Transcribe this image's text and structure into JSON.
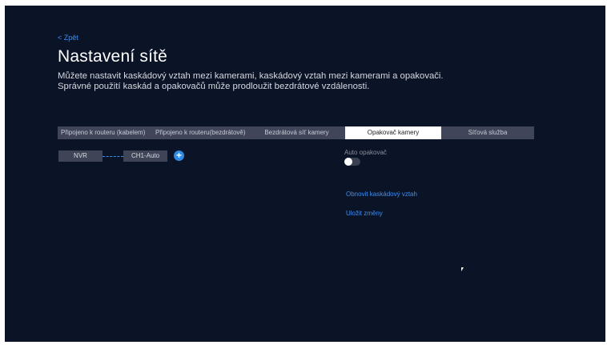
{
  "header": {
    "back_label": "< Zpět",
    "title": "Nastavení sítě",
    "description": "Můžete nastavit kaskádový vztah mezi kamerami, kaskádový vztah mezi kamerami a opakovači. Správné použití kaskád a opakovačů může prodloužit bezdrátové vzdálenosti."
  },
  "tabs": [
    {
      "label": "Připojeno k routeru (kabelem)",
      "active": false
    },
    {
      "label": "Připojeno k routeru(bezdrátově)",
      "active": false
    },
    {
      "label": "Bezdrátová síť kamery",
      "active": false
    },
    {
      "label": "Opakovač kamery",
      "active": true
    },
    {
      "label": "Síťová služba",
      "active": false
    }
  ],
  "topology": {
    "root_label": "NVR",
    "child_label": "CH1-Auto",
    "add_icon": "plus-circle-icon"
  },
  "settings": {
    "auto_repeater_label": "Auto opakovač",
    "auto_repeater_enabled": false
  },
  "actions": {
    "refresh_label": "Obnovit kaskádový vztah",
    "save_label": "Uložit změny"
  },
  "colors": {
    "background": "#0b1327",
    "accent": "#3d8ff0",
    "tab_bar": "#41455a",
    "node": "#3f4456"
  }
}
